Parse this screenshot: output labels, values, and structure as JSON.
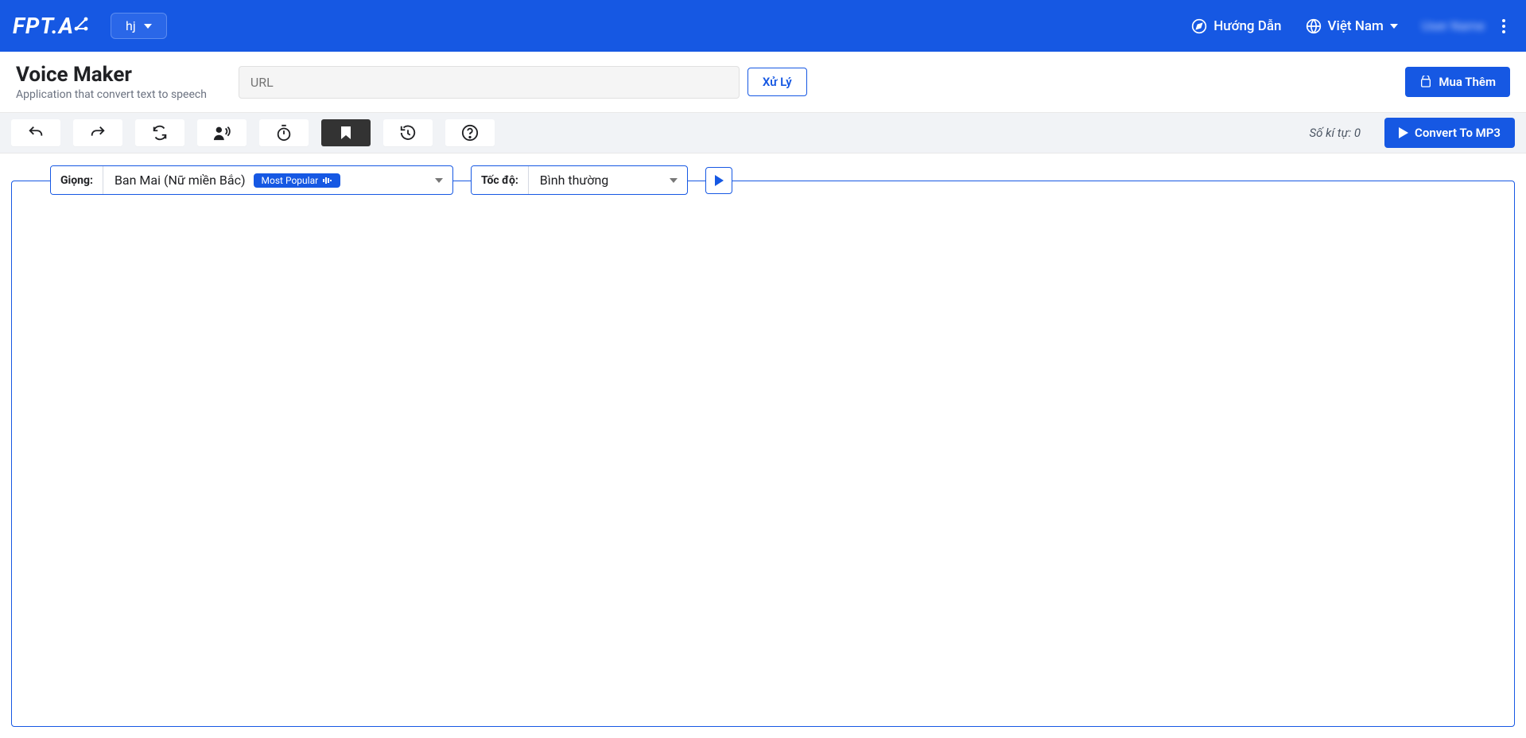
{
  "header": {
    "logo_text": "FPT.A",
    "project_select": "hj",
    "guide_label": "Hướng Dẫn",
    "region_label": "Việt Nam",
    "account_text": "User Name"
  },
  "subheader": {
    "title": "Voice Maker",
    "subtitle": "Application that convert text to speech",
    "url_placeholder": "URL",
    "process_btn": "Xử Lý",
    "buy_more_btn": "Mua Thêm"
  },
  "toolbar": {
    "char_count_label": "Số kí tự:",
    "char_count_value": "0",
    "convert_btn": "Convert To MP3"
  },
  "editor": {
    "voice_label": "Giọng:",
    "voice_value": "Ban Mai (Nữ miền Bắc)",
    "voice_badge": "Most Popular",
    "speed_label": "Tốc độ:",
    "speed_value": "Bình thường"
  }
}
